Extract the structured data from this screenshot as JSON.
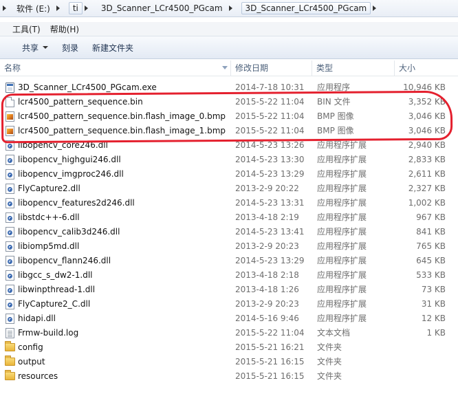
{
  "address": {
    "segments": [
      "软件 (E:)",
      "ti",
      "3D_Scanner_LCr4500_PGcam",
      "3D_Scanner_LCr4500_PGcam"
    ]
  },
  "menu": {
    "tools": "工具(T)",
    "help": "帮助(H)"
  },
  "toolbar": {
    "share": "共享",
    "burn": "刻录",
    "new_folder": "新建文件夹"
  },
  "columns": {
    "name": "名称",
    "date": "修改日期",
    "type": "类型",
    "size": "大小"
  },
  "files": [
    {
      "icon": "exe",
      "name": "3D_Scanner_LCr4500_PGcam.exe",
      "date": "2014-7-18 10:31",
      "type": "应用程序",
      "size": "10,946 KB"
    },
    {
      "icon": "blank",
      "name": "lcr4500_pattern_sequence.bin",
      "date": "2015-5-22 11:04",
      "type": "BIN 文件",
      "size": "3,352 KB"
    },
    {
      "icon": "bmp",
      "name": "lcr4500_pattern_sequence.bin.flash_image_0.bmp",
      "date": "2015-5-22 11:04",
      "type": "BMP 图像",
      "size": "3,046 KB"
    },
    {
      "icon": "bmp",
      "name": "lcr4500_pattern_sequence.bin.flash_image_1.bmp",
      "date": "2015-5-22 11:04",
      "type": "BMP 图像",
      "size": "3,046 KB"
    },
    {
      "icon": "dll",
      "name": "libopencv_core246.dll",
      "date": "2014-5-23 13:26",
      "type": "应用程序扩展",
      "size": "2,940 KB"
    },
    {
      "icon": "dll",
      "name": "libopencv_highgui246.dll",
      "date": "2014-5-23 13:30",
      "type": "应用程序扩展",
      "size": "2,833 KB"
    },
    {
      "icon": "dll",
      "name": "libopencv_imgproc246.dll",
      "date": "2014-5-23 13:29",
      "type": "应用程序扩展",
      "size": "2,611 KB"
    },
    {
      "icon": "dll",
      "name": "FlyCapture2.dll",
      "date": "2013-2-9 20:22",
      "type": "应用程序扩展",
      "size": "2,327 KB"
    },
    {
      "icon": "dll",
      "name": "libopencv_features2d246.dll",
      "date": "2014-5-23 13:31",
      "type": "应用程序扩展",
      "size": "1,002 KB"
    },
    {
      "icon": "dll",
      "name": "libstdc++-6.dll",
      "date": "2013-4-18 2:19",
      "type": "应用程序扩展",
      "size": "967 KB"
    },
    {
      "icon": "dll",
      "name": "libopencv_calib3d246.dll",
      "date": "2014-5-23 13:41",
      "type": "应用程序扩展",
      "size": "841 KB"
    },
    {
      "icon": "dll",
      "name": "libiomp5md.dll",
      "date": "2013-2-9 20:23",
      "type": "应用程序扩展",
      "size": "765 KB"
    },
    {
      "icon": "dll",
      "name": "libopencv_flann246.dll",
      "date": "2014-5-23 13:29",
      "type": "应用程序扩展",
      "size": "645 KB"
    },
    {
      "icon": "dll",
      "name": "libgcc_s_dw2-1.dll",
      "date": "2013-4-18 2:18",
      "type": "应用程序扩展",
      "size": "533 KB"
    },
    {
      "icon": "dll",
      "name": "libwinpthread-1.dll",
      "date": "2013-4-18 1:26",
      "type": "应用程序扩展",
      "size": "73 KB"
    },
    {
      "icon": "dll",
      "name": "FlyCapture2_C.dll",
      "date": "2013-2-9 20:23",
      "type": "应用程序扩展",
      "size": "31 KB"
    },
    {
      "icon": "dll",
      "name": "hidapi.dll",
      "date": "2014-5-16 9:46",
      "type": "应用程序扩展",
      "size": "12 KB"
    },
    {
      "icon": "log",
      "name": "Frmw-build.log",
      "date": "2015-5-22 11:04",
      "type": "文本文档",
      "size": "1 KB"
    },
    {
      "icon": "folder",
      "name": "config",
      "date": "2015-5-21 16:21",
      "type": "文件夹",
      "size": ""
    },
    {
      "icon": "folder",
      "name": "output",
      "date": "2015-5-21 16:15",
      "type": "文件夹",
      "size": ""
    },
    {
      "icon": "folder",
      "name": "resources",
      "date": "2015-5-21 16:15",
      "type": "文件夹",
      "size": ""
    }
  ],
  "colors": {
    "highlight": "#e4202e",
    "header_text": "#4c607a",
    "meta_text": "#6d6d6d"
  }
}
